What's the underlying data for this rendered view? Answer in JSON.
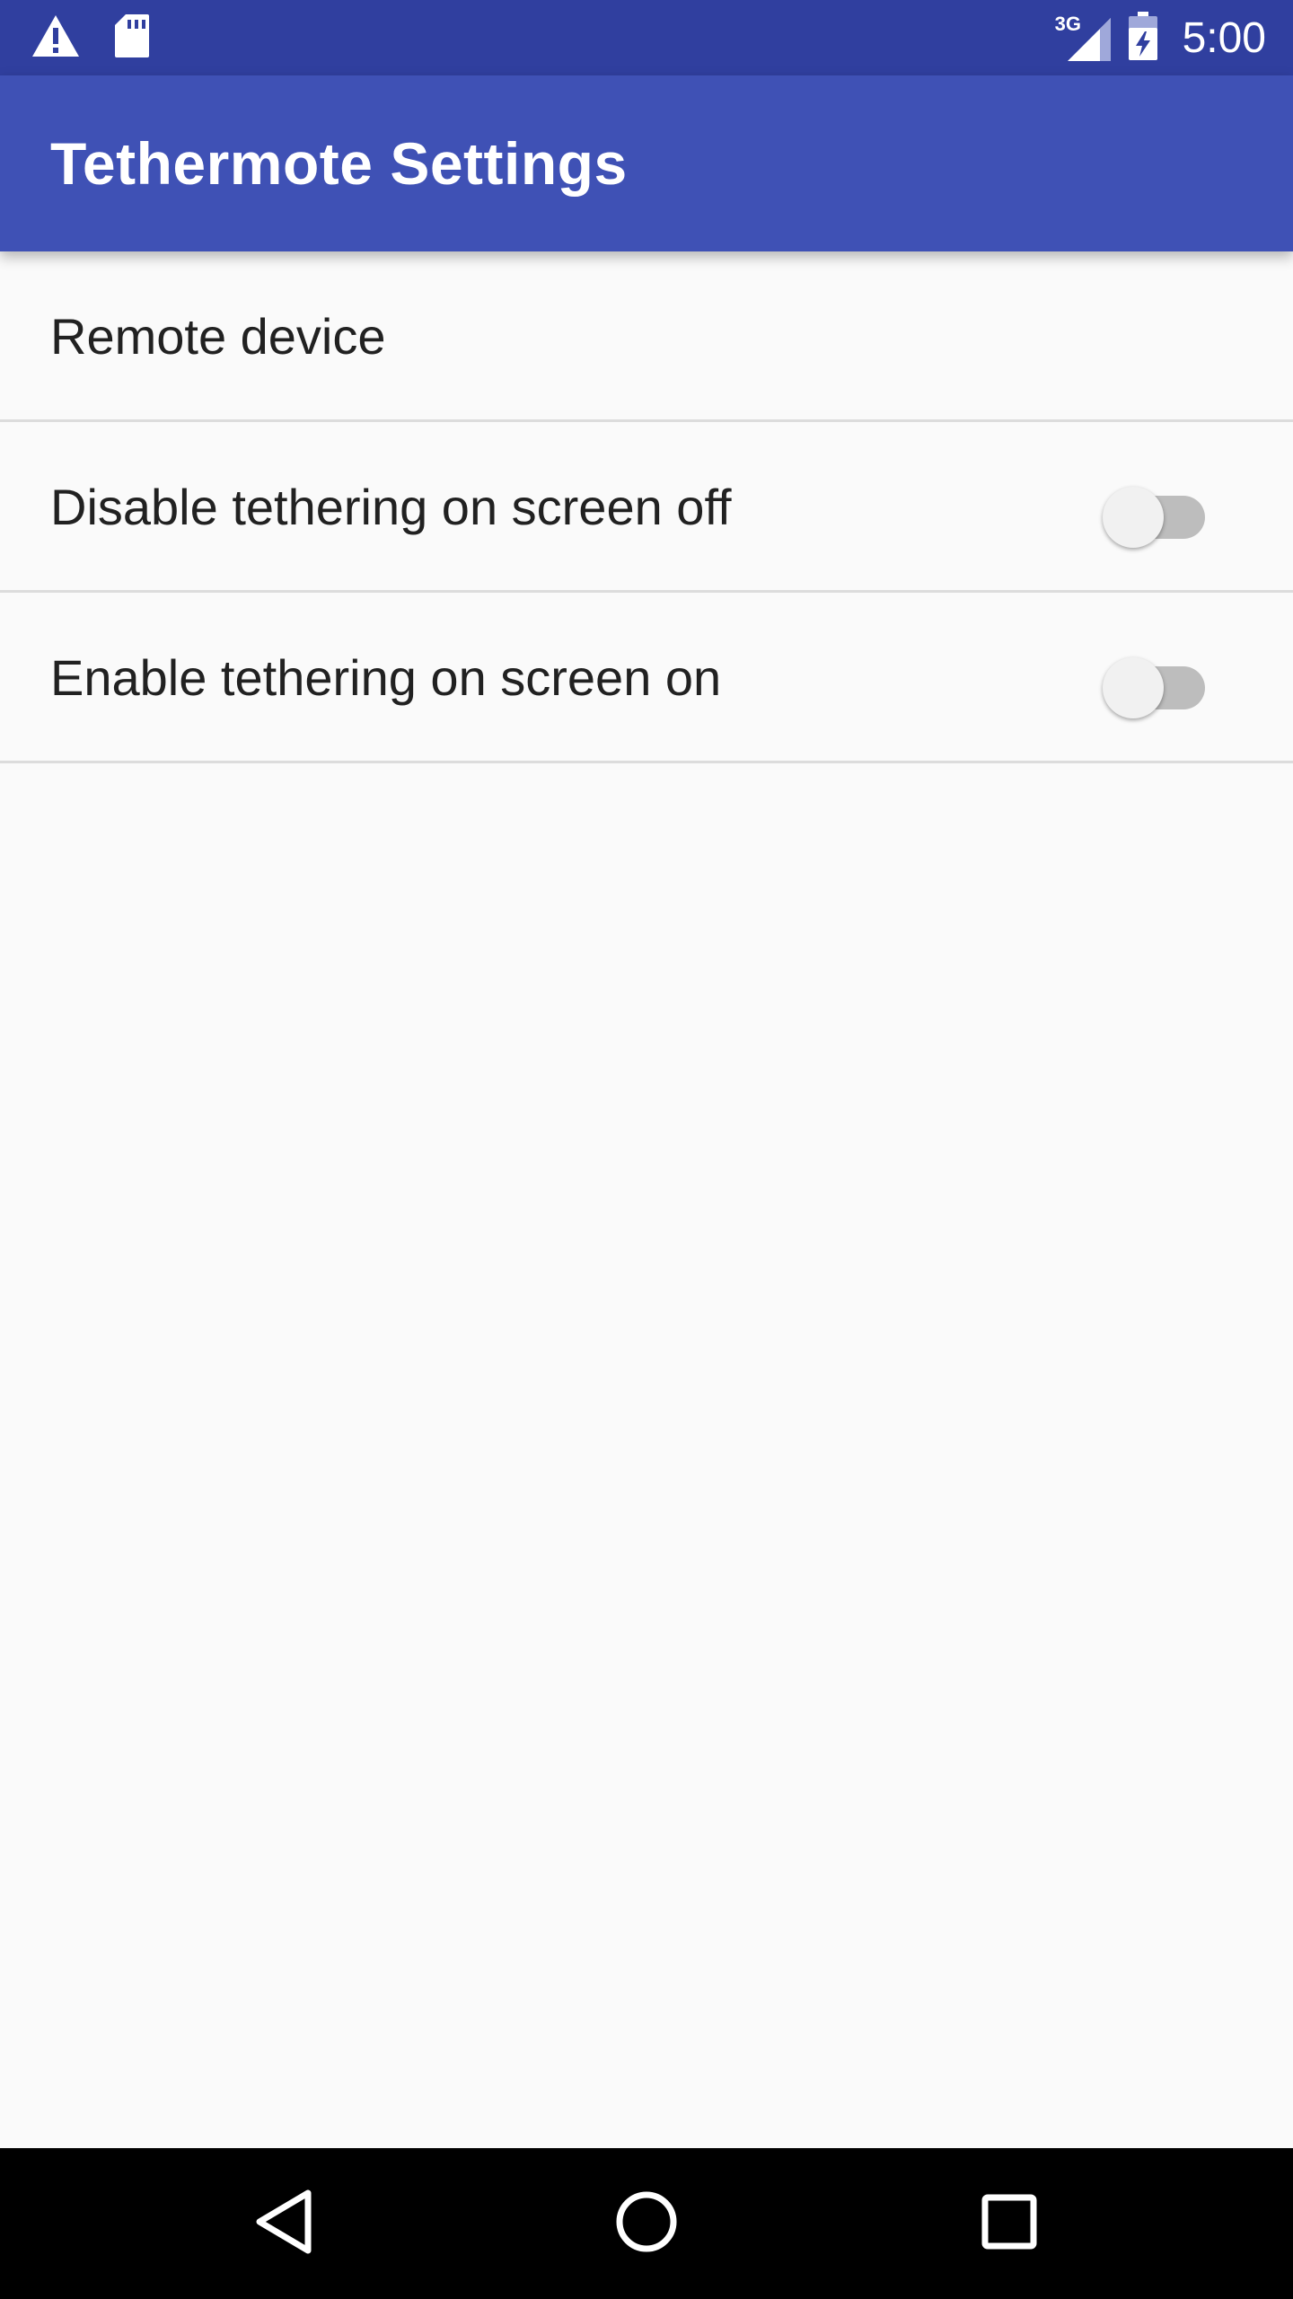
{
  "status_bar": {
    "time": "5:00",
    "network_label": "3G",
    "icons": [
      "warning-icon",
      "sd-card-icon",
      "signal-3g-icon",
      "battery-charging-icon"
    ]
  },
  "app_bar": {
    "title": "Tethermote Settings",
    "color": "#3f51b5"
  },
  "preferences": [
    {
      "title": "Remote device",
      "type": "item"
    },
    {
      "title": "Disable tethering on screen off",
      "type": "switch",
      "checked": false
    },
    {
      "title": "Enable tethering on screen on",
      "type": "switch",
      "checked": false
    }
  ],
  "nav_bar": {
    "buttons": [
      "back-icon",
      "home-icon",
      "recents-icon"
    ]
  }
}
